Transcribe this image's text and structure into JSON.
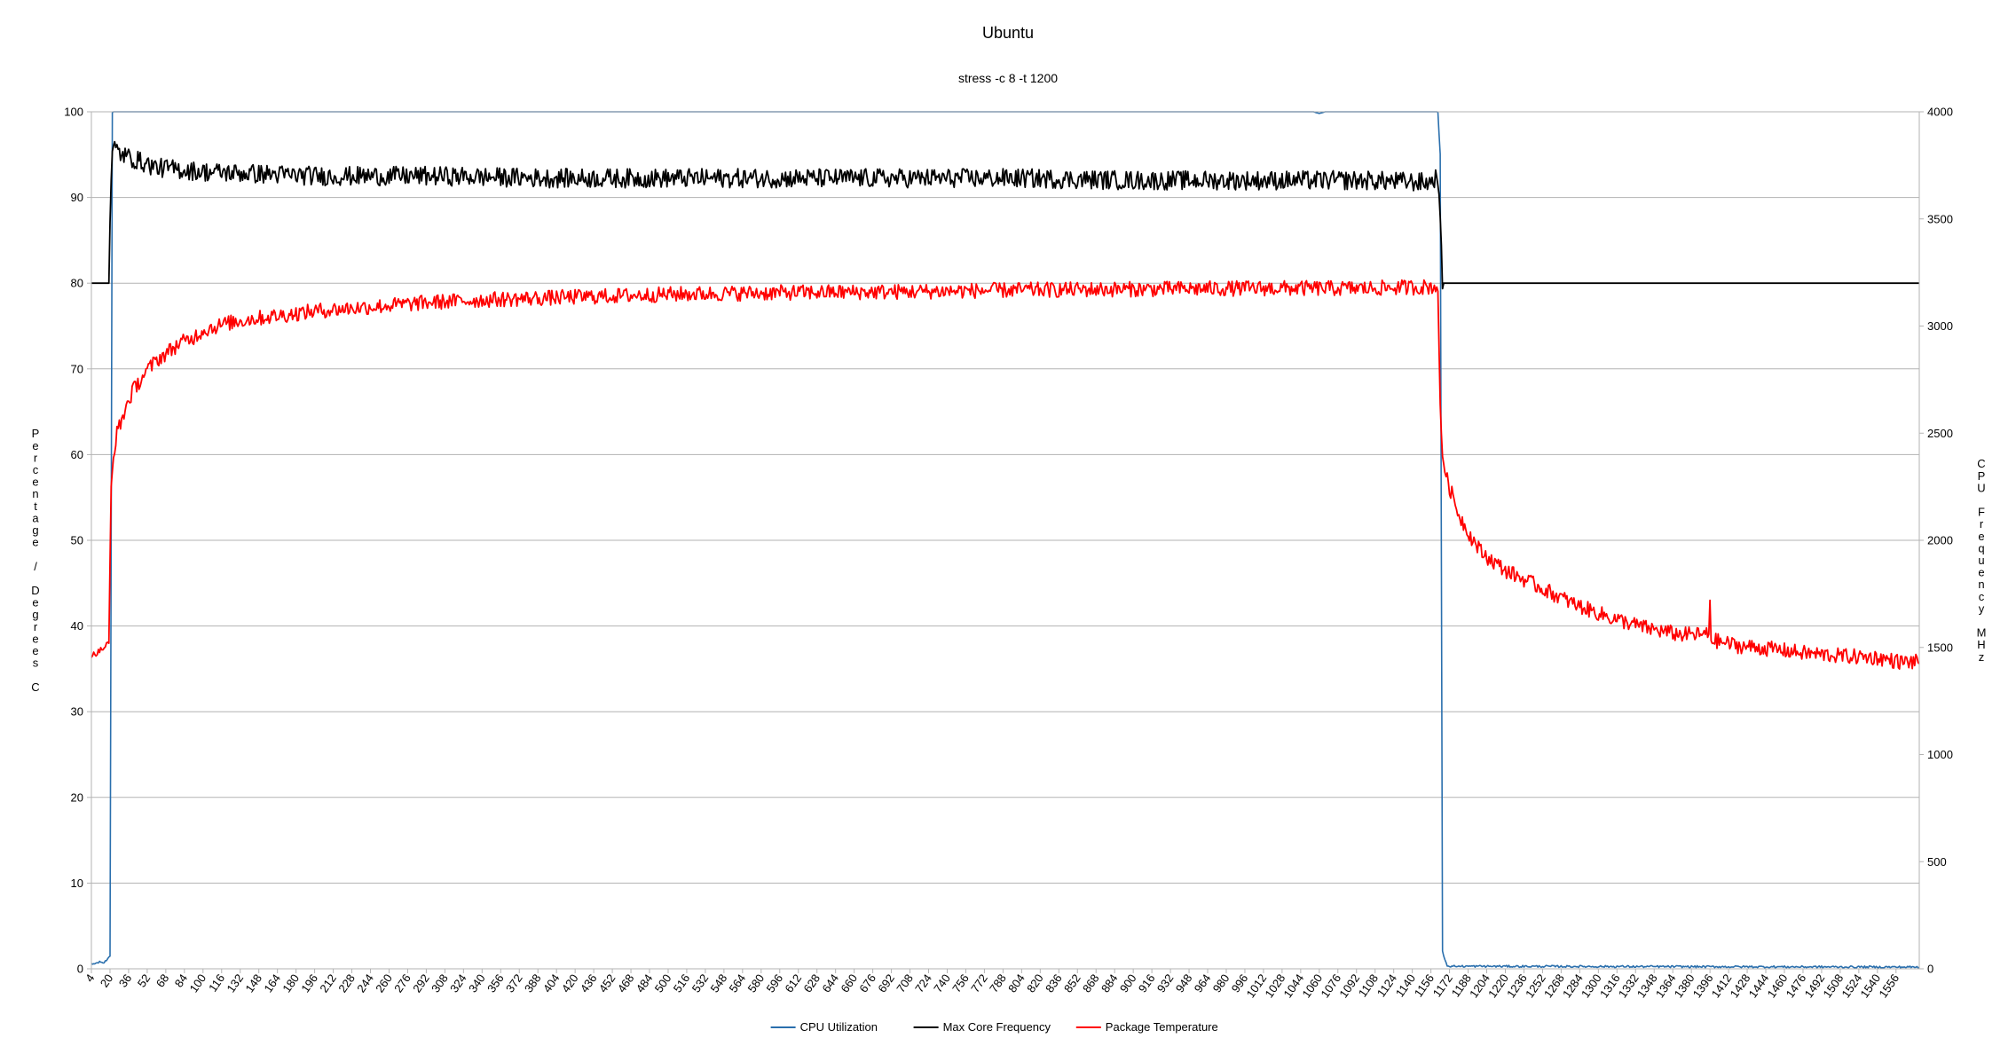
{
  "chart_data": {
    "type": "line",
    "title": "Ubuntu",
    "subtitle": "stress -c 8 -t 1200",
    "ylabel": "Percentage / Degrees C",
    "y2label": "CPU Frequency MHz",
    "xlabel": "",
    "xlim": [
      4,
      1576
    ],
    "ylim": [
      0,
      100
    ],
    "y2lim": [
      0,
      4000
    ],
    "yticks": [
      0,
      10,
      20,
      30,
      40,
      50,
      60,
      70,
      80,
      90,
      100
    ],
    "y2ticks": [
      0,
      500,
      1000,
      1500,
      2000,
      2500,
      3000,
      3500,
      4000
    ],
    "xtick_start": 4,
    "xtick_step": 16,
    "xtick_count": 98,
    "grid": true,
    "legend_position": "bottom",
    "series": [
      {
        "name": "CPU Utilization",
        "axis": "left",
        "color": "#2a6fad",
        "x": [
          4,
          12,
          15,
          18,
          20,
          22,
          1055,
          1060,
          1065,
          1162,
          1164,
          1166,
          1170,
          1576
        ],
        "y": [
          0.5,
          0.8,
          0.7,
          1.2,
          1.5,
          100,
          100,
          99.8,
          100,
          100,
          95,
          2,
          0.3,
          0.2
        ]
      },
      {
        "name": "Max Core Frequency",
        "axis": "right",
        "color": "#000000",
        "x": [
          4,
          19,
          20,
          22,
          24,
          30,
          40,
          60,
          80,
          100,
          150,
          200,
          300,
          400,
          500,
          600,
          700,
          800,
          900,
          1000,
          1100,
          1155,
          1162,
          1163,
          1166,
          1576
        ],
        "y": [
          3200,
          3200,
          3500,
          3810,
          3830,
          3800,
          3780,
          3740,
          3730,
          3720,
          3710,
          3700,
          3700,
          3690,
          3690,
          3690,
          3690,
          3690,
          3680,
          3680,
          3680,
          3670,
          3700,
          3600,
          3200,
          3200
        ]
      },
      {
        "name": "Package Temperature",
        "axis": "left",
        "color": "#ff0000",
        "x": [
          4,
          10,
          15,
          19,
          21,
          22,
          24,
          26,
          30,
          35,
          40,
          50,
          60,
          70,
          80,
          90,
          100,
          120,
          140,
          170,
          200,
          250,
          300,
          350,
          400,
          450,
          500,
          600,
          700,
          800,
          900,
          1000,
          1100,
          1162,
          1164,
          1166,
          1170,
          1180,
          1190,
          1200,
          1220,
          1250,
          1280,
          1310,
          1340,
          1370,
          1395,
          1396,
          1397,
          1400,
          1420,
          1450,
          1480,
          1510,
          1540,
          1560,
          1576
        ],
        "y": [
          36.5,
          37,
          37.5,
          38,
          56,
          58,
          61,
          62.5,
          64,
          66,
          67.5,
          69.5,
          71,
          72,
          73,
          73.5,
          74.5,
          75.3,
          75.8,
          76.3,
          76.8,
          77.3,
          77.8,
          78.1,
          78.3,
          78.5,
          78.7,
          78.9,
          79.0,
          79.2,
          79.3,
          79.4,
          79.4,
          79.6,
          65,
          60,
          57,
          53,
          50.5,
          48.5,
          46.5,
          44.5,
          42.5,
          41,
          39.8,
          39,
          39,
          43,
          38.5,
          38.3,
          37.7,
          37.3,
          36.8,
          36.5,
          36.3,
          35.8,
          35.8
        ]
      }
    ]
  }
}
